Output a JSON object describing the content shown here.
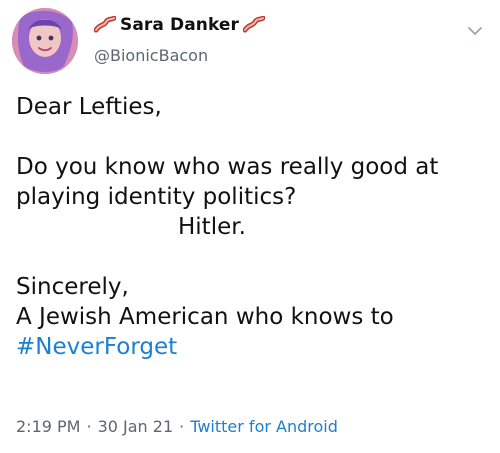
{
  "tweet": {
    "author": {
      "display_name": "Sara Danker",
      "handle": "@BionicBacon",
      "name_emoji_left": "bacon-icon",
      "name_emoji_right": "bacon-icon"
    },
    "text_lines": {
      "l1": "Dear Lefties,",
      "l2": "Do you know who was really good at",
      "l3": "playing identity politics?",
      "l4": "Hitler.",
      "l5": "Sincerely,",
      "l6": "A Jewish American who knows to",
      "hashtag": "#NeverForget"
    },
    "meta": {
      "time": "2:19 PM",
      "dot1": "·",
      "date": "30 Jan 21",
      "dot2": "·",
      "source": "Twitter for Android"
    }
  },
  "colors": {
    "link": "#1d7fd0",
    "secondary_text": "#5b6670",
    "primary_text": "#111111"
  }
}
